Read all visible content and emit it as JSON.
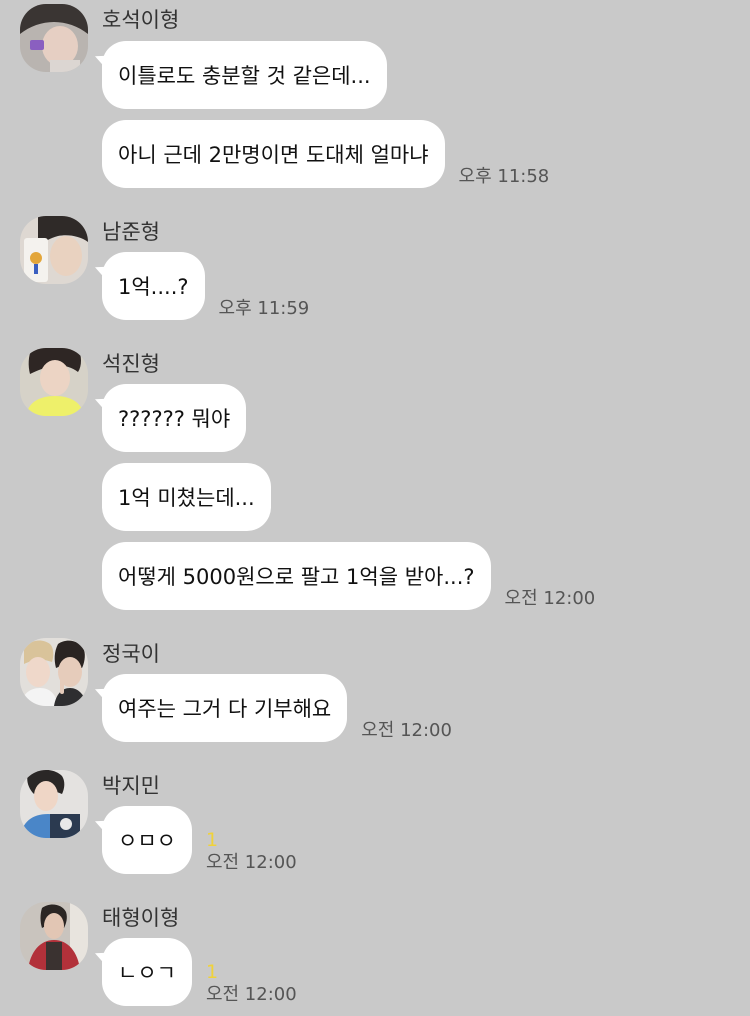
{
  "colors": {
    "background": "#c9c9c9",
    "bubble": "#ffffff",
    "unread": "#f0d23a",
    "timestamp": "#555555"
  },
  "messages": [
    {
      "sender": "호석이형",
      "bubbles": [
        "이틀로도 충분할 것 같은데...",
        "아니 근데 2만명이면 도대체 얼마냐"
      ],
      "time": "오후 11:58",
      "unread": ""
    },
    {
      "sender": "남준형",
      "bubbles": [
        "1억....?"
      ],
      "time": "오후 11:59",
      "unread": ""
    },
    {
      "sender": "석진형",
      "bubbles": [
        "?????? 뭐야",
        "1억 미쳤는데...",
        "어떻게 5000원으로 팔고 1억을 받아...?"
      ],
      "time": "오전 12:00",
      "unread": ""
    },
    {
      "sender": "정국이",
      "bubbles": [
        "여주는 그거 다 기부해요"
      ],
      "time": "오전 12:00",
      "unread": ""
    },
    {
      "sender": "박지민",
      "bubbles": [
        "ㅇㅁㅇ"
      ],
      "time": "오전 12:00",
      "unread": "1"
    },
    {
      "sender": "태형이형",
      "bubbles": [
        "ㄴㅇㄱ"
      ],
      "time": "오전 12:00",
      "unread": "1"
    }
  ]
}
